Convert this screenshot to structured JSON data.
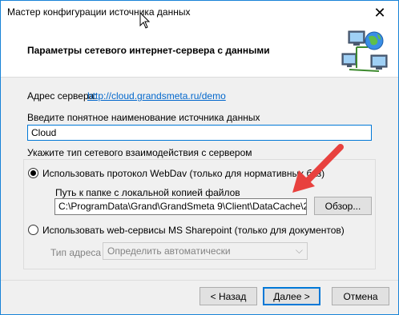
{
  "window": {
    "title": "Мастер конфигурации источника данных",
    "close_glyph": "✕"
  },
  "header": {
    "title": "Параметры сетевого интернет-сервера с данными",
    "icon": "network-computers-globe-icon"
  },
  "server": {
    "label": "Адрес сервера:",
    "url": "http://cloud.grandsmeta.ru/demo"
  },
  "source_name": {
    "label": "Введите понятное наименование источника данных",
    "value": "Cloud"
  },
  "interaction": {
    "label": "Укажите тип сетевого взаимодействия с сервером",
    "webdav": {
      "label": "Использовать протокол WebDav (только для нормативных баз)",
      "checked": true,
      "path_label": "Путь к папке с локальной копией файлов",
      "path_value": "C:\\ProgramData\\Grand\\GrandSmeta 9\\Client\\DataCache\\2",
      "browse_label": "Обзор..."
    },
    "sharepoint": {
      "label": "Использовать web-сервисы MS Sharepoint (только для документов)",
      "checked": false,
      "address_type_label": "Тип адреса",
      "address_type_value": "Определить автоматически"
    }
  },
  "footer": {
    "back_label": "< Назад",
    "next_label": "Далее >",
    "cancel_label": "Отмена"
  },
  "colors": {
    "accent": "#0078d7",
    "link": "#0066cc",
    "annotation_arrow": "#e8413e"
  }
}
